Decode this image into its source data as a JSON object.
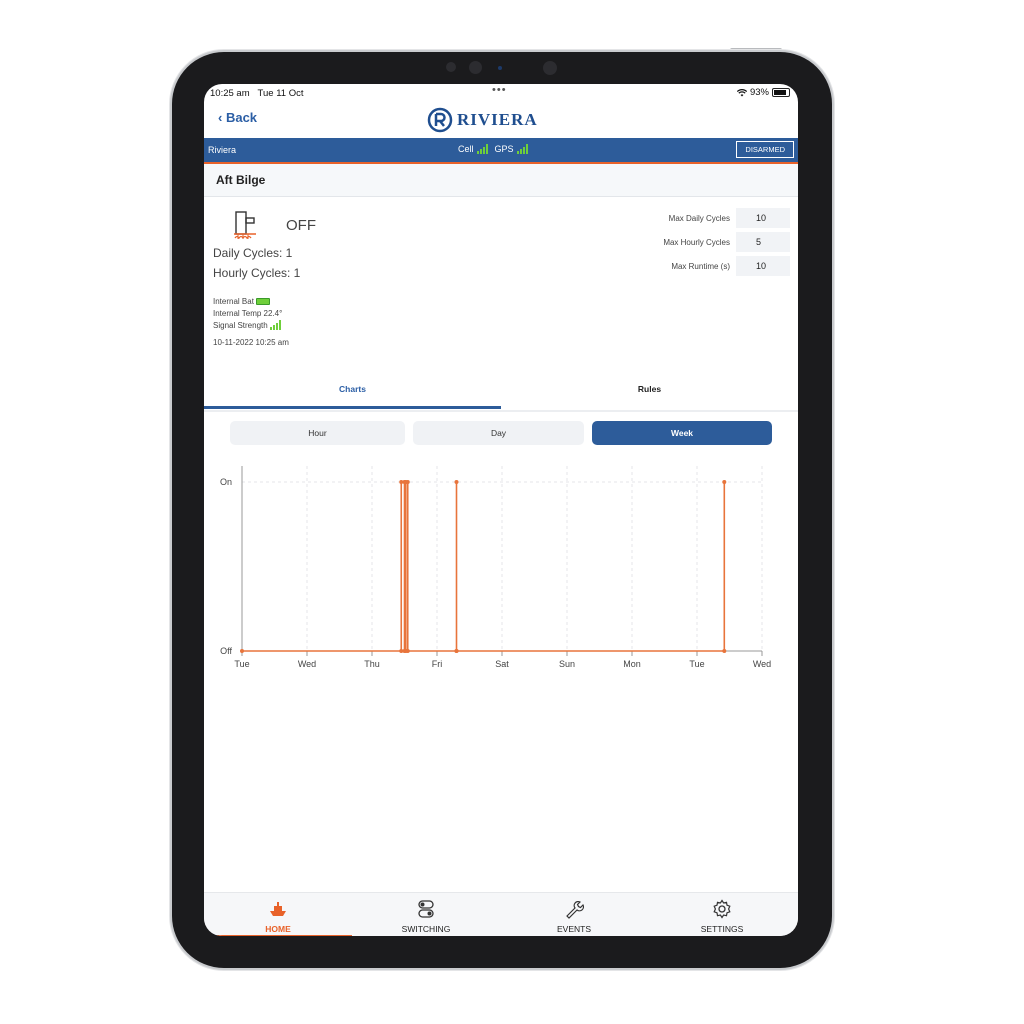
{
  "status_bar": {
    "time": "10:25 am",
    "date": "Tue 11 Oct",
    "battery": "93%",
    "dots": "•••"
  },
  "nav": {
    "back_label": "Back",
    "logo_text": "RIVIERA"
  },
  "header_bar": {
    "boat_name": "Riviera",
    "cell_label": "Cell",
    "gps_label": "GPS",
    "disarmed_label": "DISARMED"
  },
  "page": {
    "title": "Aft Bilge"
  },
  "device": {
    "state": "OFF",
    "daily_cycles": "Daily Cycles: 1",
    "hourly_cycles": "Hourly Cycles: 1",
    "internal_bat": "Internal Bat",
    "internal_temp": "Internal Temp 22.4°",
    "signal_strength": "Signal Strength",
    "timestamp": "10-11-2022 10:25 am"
  },
  "limits": [
    {
      "label": "Max Daily Cycles",
      "value": "10"
    },
    {
      "label": "Max Hourly Cycles",
      "value": "5"
    },
    {
      "label": "Max Runtime (s)",
      "value": "10"
    }
  ],
  "tabs": {
    "charts": "Charts",
    "rules": "Rules",
    "active": "Charts"
  },
  "ranges": {
    "hour": "Hour",
    "day": "Day",
    "week": "Week",
    "active": "Week"
  },
  "chart_data": {
    "type": "line",
    "x_ticks": [
      "Tue",
      "Wed",
      "Thu",
      "Fri",
      "Sat",
      "Sun",
      "Mon",
      "Tue",
      "Wed"
    ],
    "y_ticks": [
      "Off",
      "On"
    ],
    "xlim": [
      0,
      8
    ],
    "ylim": [
      0,
      1
    ],
    "grid": true,
    "series": [
      {
        "color": "#e8743b",
        "points": [
          [
            0.0,
            0
          ],
          [
            2.45,
            0
          ],
          [
            2.45,
            1
          ],
          [
            2.5,
            1
          ],
          [
            2.5,
            0
          ],
          [
            2.52,
            0
          ],
          [
            2.52,
            1
          ],
          [
            2.55,
            1
          ],
          [
            2.55,
            0
          ],
          [
            3.3,
            0
          ],
          [
            3.3,
            1
          ],
          [
            3.3,
            0
          ],
          [
            7.42,
            0
          ],
          [
            7.42,
            1
          ]
        ]
      }
    ]
  },
  "tabbar": [
    {
      "label": "HOME",
      "icon": "boat-icon",
      "active": true
    },
    {
      "label": "SWITCHING",
      "icon": "toggle-switch-icon",
      "active": false
    },
    {
      "label": "EVENTS",
      "icon": "wrench-icon",
      "active": false
    },
    {
      "label": "SETTINGS",
      "icon": "gear-icon",
      "active": false
    }
  ],
  "colors": {
    "brand_blue": "#2d5c9a",
    "accent_orange": "#e8622a",
    "signal_green": "#6fcf3a",
    "chart_line": "#e8743b"
  }
}
